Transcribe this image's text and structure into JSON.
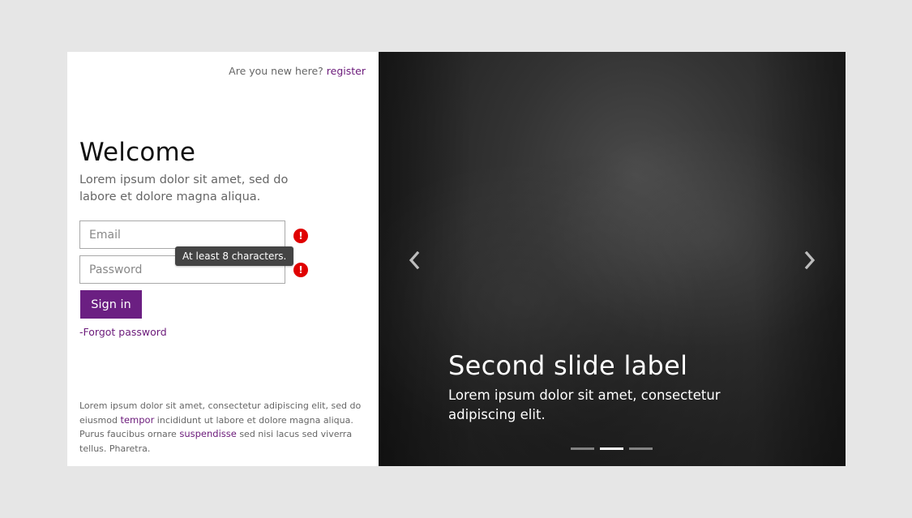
{
  "header": {
    "prompt": "Are you new here?",
    "register_link": "register"
  },
  "welcome": {
    "title": "Welcome",
    "intro": "Lorem ipsum dolor sit amet, sed do labore et dolore magna aliqua."
  },
  "form": {
    "email_placeholder": "Email",
    "email_value": "",
    "password_placeholder": "Password",
    "password_value": "",
    "error_icon_glyph": "!",
    "tooltip": "At least 8 characters.",
    "signin_label": "Sign in",
    "forgot_label": "-Forgot password"
  },
  "footer": {
    "part1": "Lorem ipsum dolor sit amet, consectetur adipiscing elit, sed do eiusmod ",
    "link1": "tempor",
    "part2": " incididunt ut labore et dolore magna aliqua. Purus faucibus ornare ",
    "link2": "suspendisse",
    "part3": " sed nisi lacus sed viverra tellus. Pharetra."
  },
  "carousel": {
    "slide_label": "Second slide label",
    "slide_caption": "Lorem ipsum dolor sit amet, consectetur adipiscing elit.",
    "indicator_count": 3,
    "active_index": 1,
    "prev_icon": "chevron-left-icon",
    "next_icon": "chevron-right-icon"
  },
  "colors": {
    "accent": "#6b1f82",
    "link": "#6b1a7a",
    "error": "#e00000",
    "page_bg": "#e6e6e6"
  }
}
